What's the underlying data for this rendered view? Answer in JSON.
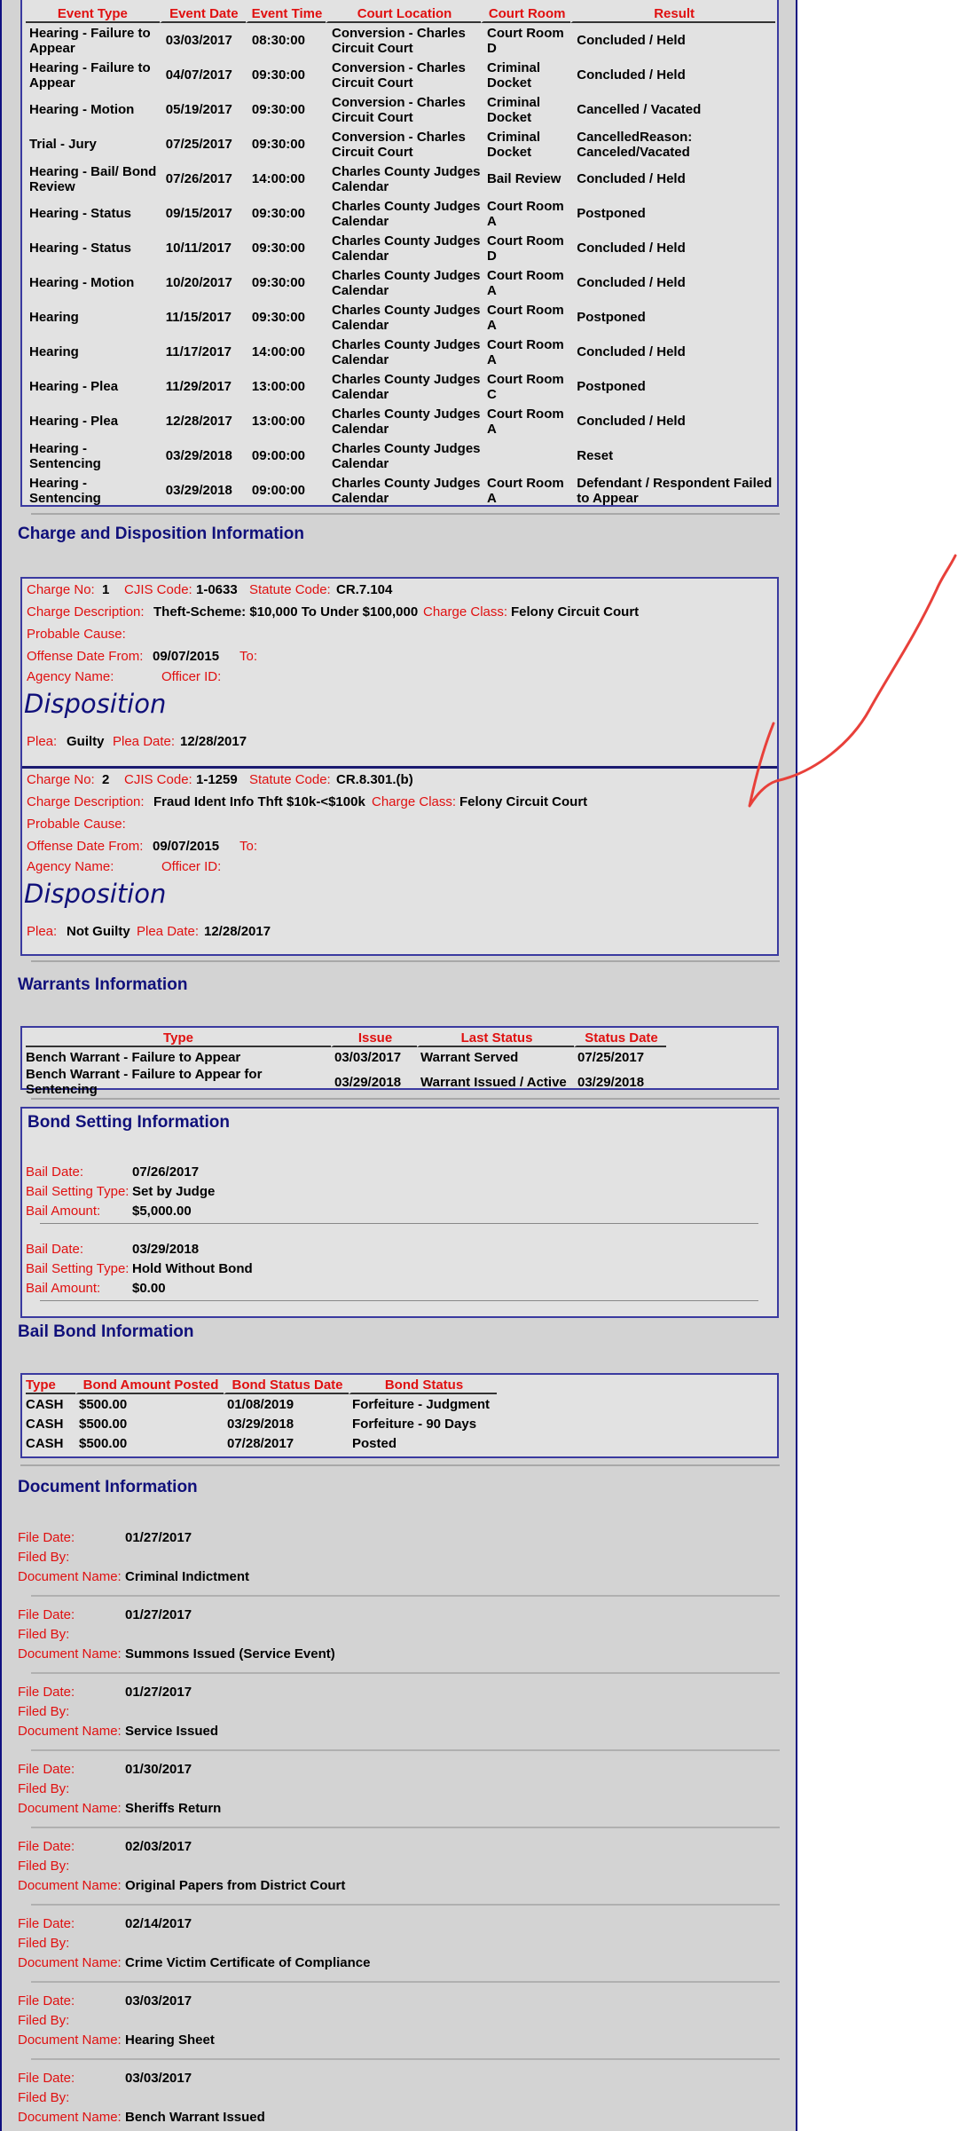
{
  "events": {
    "headers": [
      "Event Type",
      "Event Date",
      "Event Time",
      "Court Location",
      "Court Room",
      "Result"
    ],
    "rows": [
      [
        "Hearing - Failure to Appear",
        "03/03/2017",
        "08:30:00",
        "Conversion - Charles Circuit Court",
        "Court Room D",
        "Concluded / Held"
      ],
      [
        "Hearing - Failure to Appear",
        "04/07/2017",
        "09:30:00",
        "Conversion - Charles Circuit Court",
        "Criminal Docket",
        "Concluded / Held"
      ],
      [
        "Hearing - Motion",
        "05/19/2017",
        "09:30:00",
        "Conversion - Charles Circuit Court",
        "Criminal Docket",
        "Cancelled / Vacated"
      ],
      [
        "Trial - Jury",
        "07/25/2017",
        "09:30:00",
        "Conversion - Charles Circuit Court",
        "Criminal Docket",
        "CancelledReason: Canceled/Vacated"
      ],
      [
        "Hearing - Bail/ Bond Review",
        "07/26/2017",
        "14:00:00",
        "Charles County Judges Calendar",
        "Bail Review",
        "Concluded / Held"
      ],
      [
        "Hearing - Status",
        "09/15/2017",
        "09:30:00",
        "Charles County Judges Calendar",
        "Court Room A",
        "Postponed"
      ],
      [
        "Hearing - Status",
        "10/11/2017",
        "09:30:00",
        "Charles County Judges Calendar",
        "Court Room D",
        "Concluded / Held"
      ],
      [
        "Hearing - Motion",
        "10/20/2017",
        "09:30:00",
        "Charles County Judges Calendar",
        "Court Room A",
        "Concluded / Held"
      ],
      [
        "Hearing",
        "11/15/2017",
        "09:30:00",
        "Charles County Judges Calendar",
        "Court Room A",
        "Postponed"
      ],
      [
        "Hearing",
        "11/17/2017",
        "14:00:00",
        "Charles County Judges Calendar",
        "Court Room A",
        "Concluded / Held"
      ],
      [
        "Hearing - Plea",
        "11/29/2017",
        "13:00:00",
        "Charles County Judges Calendar",
        "Court Room C",
        "Postponed"
      ],
      [
        "Hearing - Plea",
        "12/28/2017",
        "13:00:00",
        "Charles County Judges Calendar",
        "Court Room A",
        "Concluded / Held"
      ],
      [
        "Hearing - Sentencing",
        "03/29/2018",
        "09:00:00",
        "Charles County Judges Calendar",
        "",
        "Reset"
      ],
      [
        "Hearing - Sentencing",
        "03/29/2018",
        "09:00:00",
        "Charles County Judges Calendar",
        "Court Room A",
        "Defendant / Respondent Failed to Appear"
      ]
    ]
  },
  "charges": {
    "title": "Charge and Disposition Information",
    "labels": {
      "charge_no": "Charge No:",
      "cjis_code": "CJIS Code:",
      "statute_code": "Statute Code:",
      "charge_description": "Charge Description:",
      "charge_class": "Charge Class:",
      "probable_cause": "Probable Cause:",
      "offense_date_from": "Offense Date From:",
      "to": "To:",
      "agency_name": "Agency Name:",
      "officer_id": "Officer ID:",
      "disposition": "Disposition",
      "plea": "Plea:",
      "plea_date": "Plea Date:"
    },
    "items": [
      {
        "charge_no": "1",
        "cjis_code": "1-0633",
        "statute_code": "CR.7.104",
        "description": "Theft-Scheme: $10,000 To Under $100,000",
        "charge_class": "Felony Circuit Court",
        "offense_date_from": "09/07/2015",
        "plea": "Guilty",
        "plea_date": "12/28/2017"
      },
      {
        "charge_no": "2",
        "cjis_code": "1-1259",
        "statute_code": "CR.8.301.(b)",
        "description": "Fraud Ident Info Thft $10k-<$100k",
        "charge_class": "Felony Circuit Court",
        "offense_date_from": "09/07/2015",
        "plea": "Not Guilty",
        "plea_date": "12/28/2017"
      }
    ]
  },
  "warrants": {
    "title": "Warrants Information",
    "headers": [
      "Type",
      "Issue",
      "Last Status",
      "Status Date"
    ],
    "rows": [
      [
        "Bench Warrant - Failure to Appear",
        "03/03/2017",
        "Warrant Served",
        "07/25/2017"
      ],
      [
        "Bench Warrant - Failure to Appear for Sentencing",
        "03/29/2018",
        "Warrant Issued / Active",
        "03/29/2018"
      ]
    ]
  },
  "bond_setting": {
    "title": "Bond Setting Information",
    "labels": {
      "bail_date": "Bail Date:",
      "bail_setting_type": "Bail Setting Type:",
      "bail_amount": "Bail Amount:"
    },
    "items": [
      {
        "bail_date": "07/26/2017",
        "bail_setting_type": "Set by Judge",
        "bail_amount": "$5,000.00"
      },
      {
        "bail_date": "03/29/2018",
        "bail_setting_type": "Hold Without Bond",
        "bail_amount": "$0.00"
      }
    ]
  },
  "bail_bond": {
    "title": "Bail Bond Information",
    "headers": [
      "Type",
      "Bond Amount Posted",
      "Bond Status Date",
      "Bond Status"
    ],
    "rows": [
      [
        "CASH",
        "$500.00",
        "01/08/2019",
        "Forfeiture - Judgment"
      ],
      [
        "CASH",
        "$500.00",
        "03/29/2018",
        "Forfeiture - 90 Days"
      ],
      [
        "CASH",
        "$500.00",
        "07/28/2017",
        "Posted"
      ]
    ]
  },
  "documents": {
    "title": "Document Information",
    "labels": {
      "file_date": "File Date:",
      "filed_by": "Filed By:",
      "document_name": "Document Name:"
    },
    "items": [
      {
        "file_date": "01/27/2017",
        "filed_by": "",
        "document_name": "Criminal Indictment"
      },
      {
        "file_date": "01/27/2017",
        "filed_by": "",
        "document_name": "Summons Issued (Service Event)"
      },
      {
        "file_date": "01/27/2017",
        "filed_by": "",
        "document_name": "Service Issued"
      },
      {
        "file_date": "01/30/2017",
        "filed_by": "",
        "document_name": "Sheriffs Return"
      },
      {
        "file_date": "02/03/2017",
        "filed_by": "",
        "document_name": "Original Papers from District Court"
      },
      {
        "file_date": "02/14/2017",
        "filed_by": "",
        "document_name": "Crime Victim Certificate of Compliance"
      },
      {
        "file_date": "03/03/2017",
        "filed_by": "",
        "document_name": "Hearing Sheet"
      },
      {
        "file_date": "03/03/2017",
        "filed_by": "",
        "document_name": "Bench Warrant Issued"
      }
    ]
  },
  "colors": {
    "label": "#e01010",
    "heading": "#10107a",
    "border": "#3a3aa0",
    "panel": "#e2e2e2",
    "page": "#d3d3d3",
    "annotation_stroke": "#e8403a"
  },
  "annotation": {
    "icon": "red-pen-stroke"
  }
}
